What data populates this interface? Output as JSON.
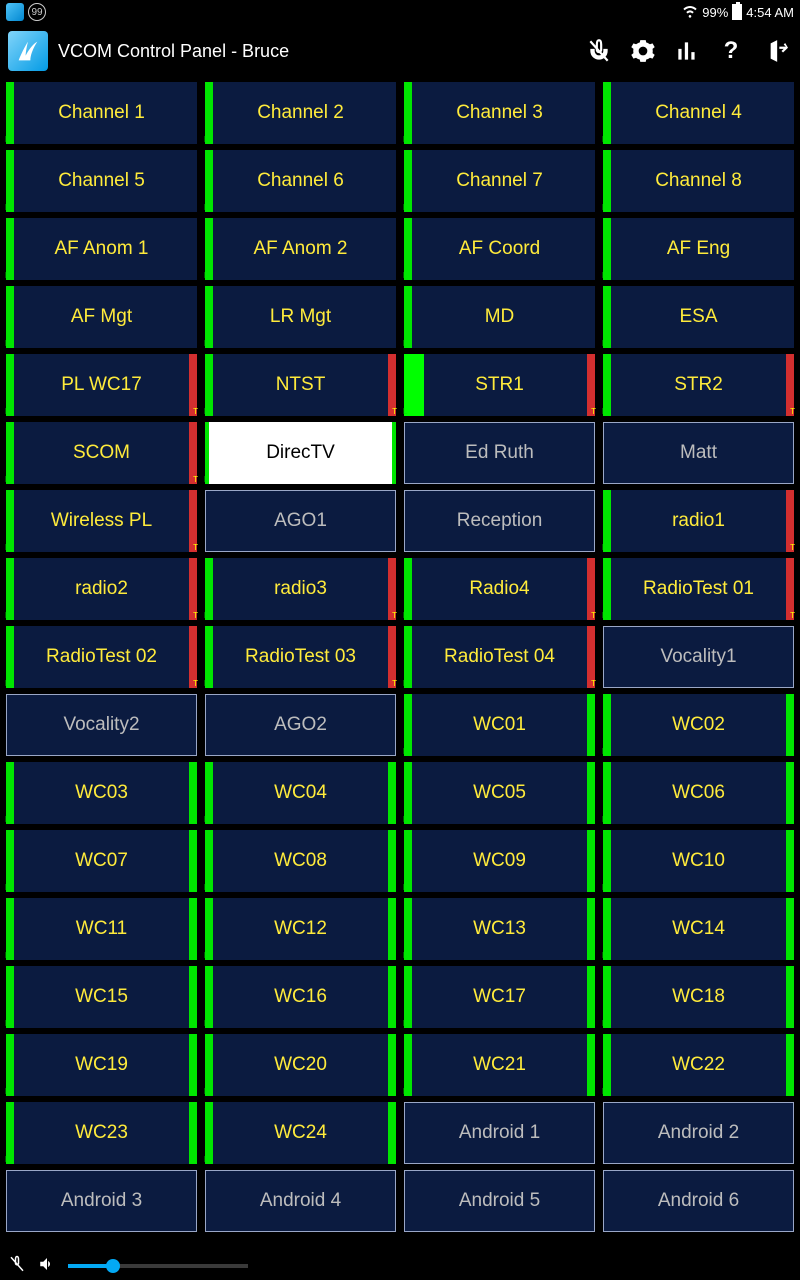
{
  "status": {
    "badge": "99",
    "battery": "99%",
    "time": "4:54 AM"
  },
  "header": {
    "title": "VCOM Control Panel - Bruce"
  },
  "cells": [
    {
      "label": "Channel 1",
      "style": "norm",
      "left": "g",
      "right": ""
    },
    {
      "label": "Channel 2",
      "style": "norm",
      "left": "g",
      "right": ""
    },
    {
      "label": "Channel 3",
      "style": "norm",
      "left": "g",
      "right": ""
    },
    {
      "label": "Channel 4",
      "style": "norm",
      "left": "g",
      "right": ""
    },
    {
      "label": "Channel 5",
      "style": "norm",
      "left": "g",
      "right": ""
    },
    {
      "label": "Channel 6",
      "style": "norm",
      "left": "g",
      "right": ""
    },
    {
      "label": "Channel 7",
      "style": "norm",
      "left": "g",
      "right": ""
    },
    {
      "label": "Channel 8",
      "style": "norm",
      "left": "g",
      "right": ""
    },
    {
      "label": "AF Anom 1",
      "style": "norm",
      "left": "g",
      "right": ""
    },
    {
      "label": "AF Anom 2",
      "style": "norm",
      "left": "g",
      "right": ""
    },
    {
      "label": "AF Coord",
      "style": "norm",
      "left": "g",
      "right": ""
    },
    {
      "label": "AF Eng",
      "style": "norm",
      "left": "g",
      "right": ""
    },
    {
      "label": "AF Mgt",
      "style": "norm",
      "left": "g",
      "right": ""
    },
    {
      "label": "LR Mgt",
      "style": "norm",
      "left": "g",
      "right": ""
    },
    {
      "label": "MD",
      "style": "norm",
      "left": "g",
      "right": ""
    },
    {
      "label": "ESA",
      "style": "norm",
      "left": "g",
      "right": ""
    },
    {
      "label": "PL WC17",
      "style": "norm",
      "left": "g",
      "right": "r",
      "t": true
    },
    {
      "label": "NTST",
      "style": "norm",
      "left": "g",
      "right": "r",
      "t": true
    },
    {
      "label": "STR1",
      "style": "active",
      "left": "G",
      "right": "r",
      "t": true
    },
    {
      "label": "STR2",
      "style": "norm",
      "left": "g",
      "right": "r",
      "t": true
    },
    {
      "label": "SCOM",
      "style": "norm",
      "left": "g",
      "right": "r",
      "t": true
    },
    {
      "label": "DirecTV",
      "style": "white",
      "left": "g",
      "right": "g"
    },
    {
      "label": "Ed Ruth",
      "style": "ghost"
    },
    {
      "label": "Matt",
      "style": "ghost"
    },
    {
      "label": "Wireless PL",
      "style": "norm",
      "left": "g",
      "right": "r",
      "t": true
    },
    {
      "label": "AGO1",
      "style": "ghost"
    },
    {
      "label": "Reception",
      "style": "ghost"
    },
    {
      "label": "radio1",
      "style": "norm",
      "left": "g",
      "right": "r",
      "t": true
    },
    {
      "label": "radio2",
      "style": "norm",
      "left": "g",
      "right": "r",
      "t": true
    },
    {
      "label": "radio3",
      "style": "norm",
      "left": "g",
      "right": "r",
      "t": true
    },
    {
      "label": "Radio4",
      "style": "norm",
      "left": "g",
      "right": "r",
      "t": true
    },
    {
      "label": "RadioTest 01",
      "style": "norm",
      "left": "g",
      "right": "r",
      "t": true
    },
    {
      "label": "RadioTest 02",
      "style": "norm",
      "left": "g",
      "right": "r",
      "t": true
    },
    {
      "label": "RadioTest 03",
      "style": "norm",
      "left": "g",
      "right": "r",
      "t": true
    },
    {
      "label": "RadioTest 04",
      "style": "norm",
      "left": "g",
      "right": "r",
      "t": true
    },
    {
      "label": "Vocality1",
      "style": "ghost"
    },
    {
      "label": "Vocality2",
      "style": "ghost"
    },
    {
      "label": "AGO2",
      "style": "ghost"
    },
    {
      "label": "WC01",
      "style": "norm",
      "left": "g",
      "right": "g"
    },
    {
      "label": "WC02",
      "style": "norm",
      "left": "g",
      "right": "g"
    },
    {
      "label": "WC03",
      "style": "norm",
      "left": "g",
      "right": "g"
    },
    {
      "label": "WC04",
      "style": "norm",
      "left": "g",
      "right": "g"
    },
    {
      "label": "WC05",
      "style": "norm",
      "left": "g",
      "right": "g"
    },
    {
      "label": "WC06",
      "style": "norm",
      "left": "g",
      "right": "g"
    },
    {
      "label": "WC07",
      "style": "norm",
      "left": "g",
      "right": "g"
    },
    {
      "label": "WC08",
      "style": "norm",
      "left": "g",
      "right": "g"
    },
    {
      "label": "WC09",
      "style": "norm",
      "left": "g",
      "right": "g"
    },
    {
      "label": "WC10",
      "style": "norm",
      "left": "g",
      "right": "g"
    },
    {
      "label": "WC11",
      "style": "norm",
      "left": "g",
      "right": "g"
    },
    {
      "label": "WC12",
      "style": "norm",
      "left": "g",
      "right": "g"
    },
    {
      "label": "WC13",
      "style": "norm",
      "left": "g",
      "right": "g"
    },
    {
      "label": "WC14",
      "style": "norm",
      "left": "g",
      "right": "g"
    },
    {
      "label": "WC15",
      "style": "norm",
      "left": "g",
      "right": "g"
    },
    {
      "label": "WC16",
      "style": "norm",
      "left": "g",
      "right": "g"
    },
    {
      "label": "WC17",
      "style": "norm",
      "left": "g",
      "right": "g"
    },
    {
      "label": "WC18",
      "style": "norm",
      "left": "g",
      "right": "g"
    },
    {
      "label": "WC19",
      "style": "norm",
      "left": "g",
      "right": "g"
    },
    {
      "label": "WC20",
      "style": "norm",
      "left": "g",
      "right": "g"
    },
    {
      "label": "WC21",
      "style": "norm",
      "left": "g",
      "right": "g"
    },
    {
      "label": "WC22",
      "style": "norm",
      "left": "g",
      "right": "g"
    },
    {
      "label": "WC23",
      "style": "norm",
      "left": "g",
      "right": "g"
    },
    {
      "label": "WC24",
      "style": "norm",
      "left": "g",
      "right": "g"
    },
    {
      "label": "Android  1",
      "style": "ghost"
    },
    {
      "label": "Android  2",
      "style": "ghost"
    },
    {
      "label": "Android  3",
      "style": "ghost"
    },
    {
      "label": "Android  4",
      "style": "ghost"
    },
    {
      "label": "Android  5",
      "style": "ghost"
    },
    {
      "label": "Android  6",
      "style": "ghost"
    }
  ],
  "help": "?"
}
